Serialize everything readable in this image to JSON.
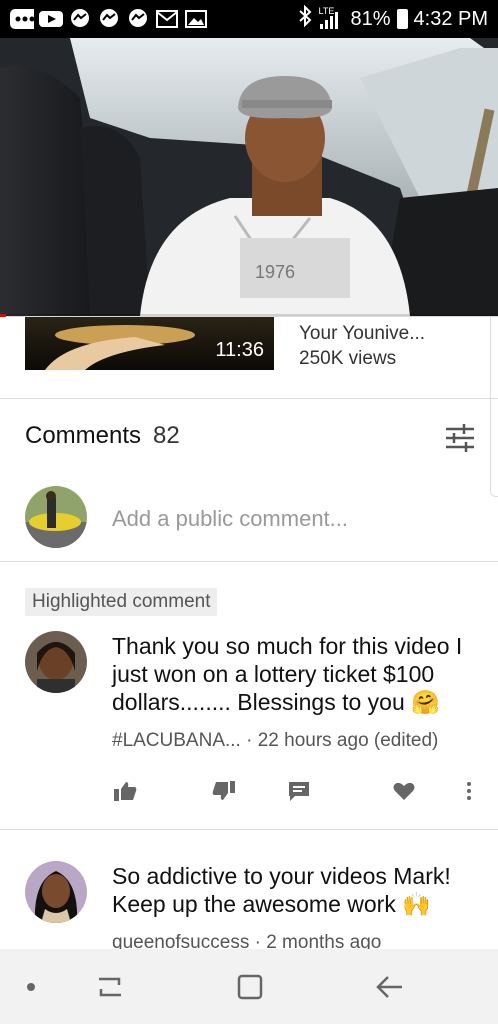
{
  "status_bar": {
    "signal_label": "LTE",
    "battery": "81%",
    "time": "4:32 PM",
    "icons": [
      "more-icon",
      "youtube-icon",
      "messenger-icon",
      "messenger-icon",
      "messenger-icon",
      "gmail-icon",
      "gallery-icon",
      "bluetooth-icon",
      "signal-icon",
      "battery-icon"
    ]
  },
  "video": {
    "progress_fraction": 0.012
  },
  "up_next": {
    "duration": "11:36",
    "title": "Your Younive...",
    "views": "250K views"
  },
  "comments": {
    "title": "Comments",
    "count": "82",
    "add_placeholder": "Add a public comment...",
    "items": [
      {
        "badge": "Highlighted comment",
        "text": "Thank you so much for this video I just won on a lottery ticket $100 dollars........ Blessings to you 🤗",
        "author": "#LACUBANA...",
        "time": "· 22 hours ago (edited)"
      },
      {
        "text": "So addictive to your videos Mark! Keep up the awesome work 🙌",
        "author": "queenofsuccess",
        "time": "· 2 months ago"
      }
    ]
  },
  "colors": {
    "progress": "#e00000",
    "nav_bg": "#f2f2f2"
  }
}
